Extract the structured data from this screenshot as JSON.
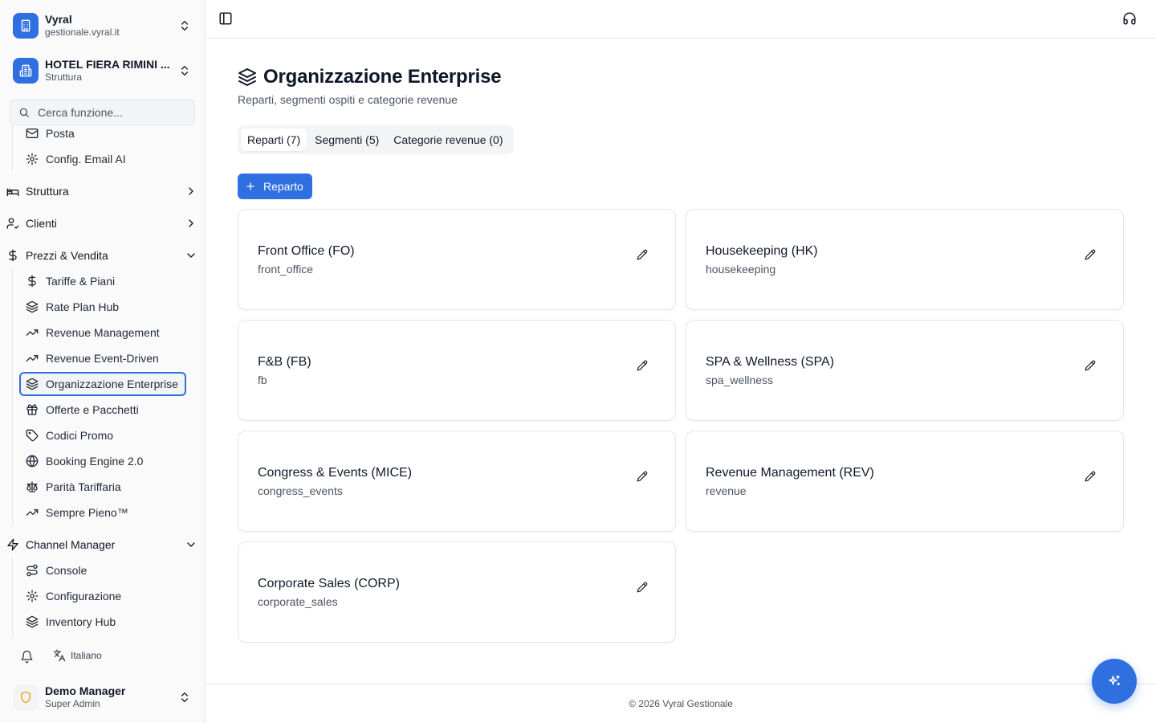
{
  "org_switcher": {
    "title": "Vyral",
    "subtitle": "gestionale.vyral.it",
    "icon": "building-icon"
  },
  "property_switcher": {
    "title": "HOTEL FIERA RIMINI ...",
    "subtitle": "Struttura",
    "icon": "hotel-icon"
  },
  "search": {
    "placeholder": "Cerca funzione..."
  },
  "sidebar": {
    "email_items": [
      {
        "label": "Posta",
        "icon": "mail-icon"
      },
      {
        "label": "Config. Email AI",
        "icon": "gear-icon"
      }
    ],
    "groups": {
      "struttura": {
        "label": "Struttura",
        "icon": "bed-icon",
        "expanded": false
      },
      "clienti": {
        "label": "Clienti",
        "icon": "user-check-icon",
        "expanded": false
      },
      "prezzi": {
        "label": "Prezzi & Vendita",
        "icon": "dollar-icon",
        "expanded": true,
        "items": [
          {
            "label": "Tariffe & Piani",
            "icon": "dollar-icon"
          },
          {
            "label": "Rate Plan Hub",
            "icon": "layers-icon"
          },
          {
            "label": "Revenue Management",
            "icon": "trend-up-icon"
          },
          {
            "label": "Revenue Event-Driven",
            "icon": "trend-up-icon"
          },
          {
            "label": "Organizzazione Enterprise",
            "icon": "layers-icon",
            "active": true
          },
          {
            "label": "Offerte e Pacchetti",
            "icon": "gift-icon"
          },
          {
            "label": "Codici Promo",
            "icon": "tag-icon"
          },
          {
            "label": "Booking Engine 2.0",
            "icon": "globe-icon"
          },
          {
            "label": "Parità Tariffaria",
            "icon": "scale-icon"
          },
          {
            "label": "Sempre Pieno™",
            "icon": "trend-up-icon"
          }
        ]
      },
      "channel": {
        "label": "Channel Manager",
        "icon": "zap-icon",
        "expanded": true,
        "items": [
          {
            "label": "Console",
            "icon": "route-icon"
          },
          {
            "label": "Configurazione",
            "icon": "gear-icon"
          },
          {
            "label": "Inventory Hub",
            "icon": "layers-icon"
          }
        ]
      }
    }
  },
  "bottom": {
    "language": "Italiano"
  },
  "user": {
    "name": "Demo Manager",
    "role": "Super Admin"
  },
  "page": {
    "title": "Organizzazione Enterprise",
    "subtitle": "Reparti, segmenti ospiti e categorie revenue"
  },
  "tabs": [
    {
      "label": "Reparti (7)",
      "active": true
    },
    {
      "label": "Segmenti (5)",
      "active": false
    },
    {
      "label": "Categorie revenue (0)",
      "active": false
    }
  ],
  "add_button": {
    "label": "Reparto"
  },
  "departments": [
    {
      "name": "Front Office (FO)",
      "code": "front_office"
    },
    {
      "name": "Housekeeping (HK)",
      "code": "housekeeping"
    },
    {
      "name": "F&B (FB)",
      "code": "fb"
    },
    {
      "name": "SPA & Wellness (SPA)",
      "code": "spa_wellness"
    },
    {
      "name": "Congress & Events (MICE)",
      "code": "congress_events"
    },
    {
      "name": "Revenue Management (REV)",
      "code": "revenue"
    },
    {
      "name": "Corporate Sales (CORP)",
      "code": "corporate_sales"
    }
  ],
  "footer": {
    "text": "© 2026 Vyral Gestionale"
  },
  "colors": {
    "accent": "#2f6fe0",
    "border": "#e5e7eb",
    "muted_text": "#4b5563"
  }
}
